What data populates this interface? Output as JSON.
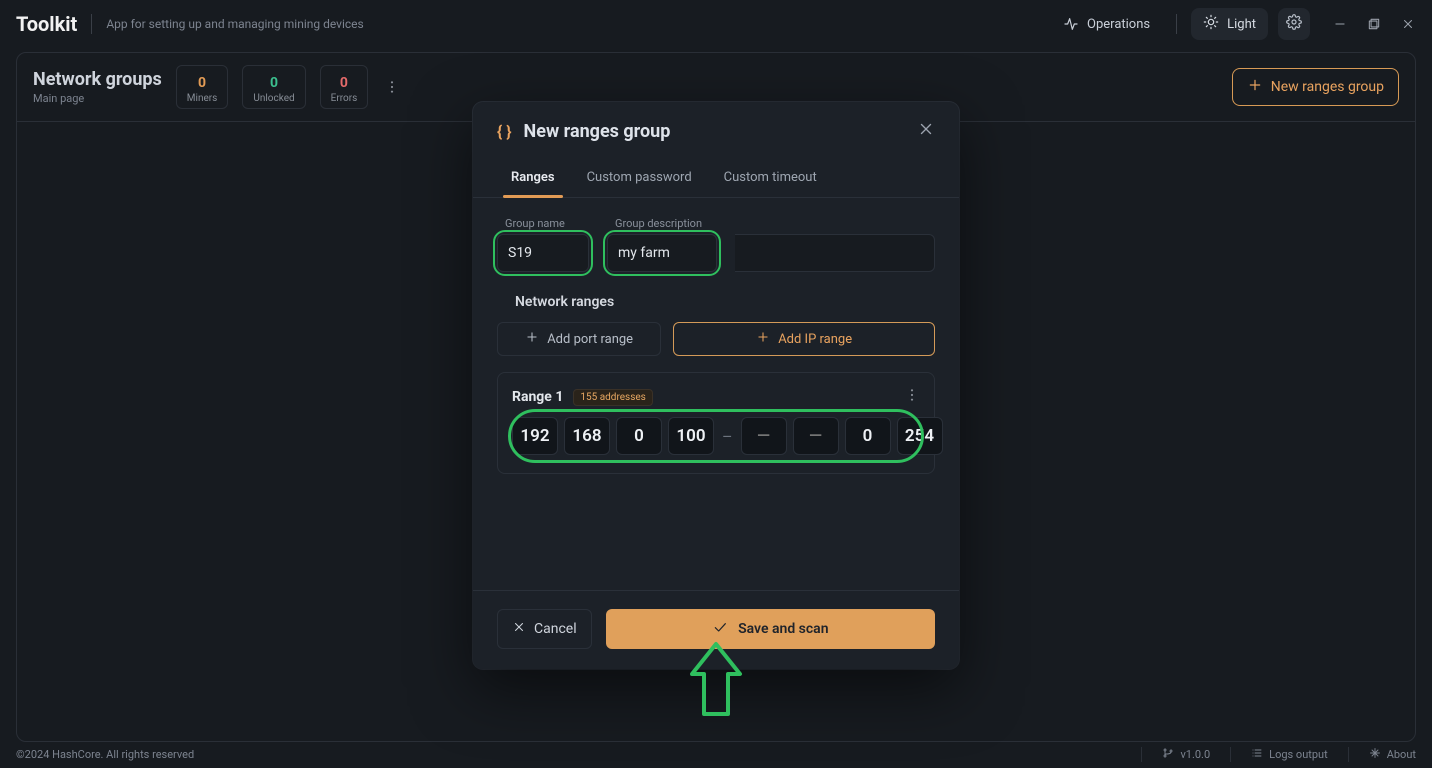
{
  "titlebar": {
    "brand": "Toolkit",
    "tagline": "App for setting up and managing mining devices",
    "operations": "Operations",
    "theme_label": "Light"
  },
  "page": {
    "title": "Network groups",
    "subtitle": "Main page",
    "stats": {
      "miners": {
        "value": "0",
        "label": "Miners"
      },
      "unlocked": {
        "value": "0",
        "label": "Unlocked"
      },
      "errors": {
        "value": "0",
        "label": "Errors"
      }
    },
    "new_group_btn": "New ranges group"
  },
  "modal": {
    "title": "New ranges group",
    "tabs": {
      "ranges": "Ranges",
      "password": "Custom password",
      "timeout": "Custom timeout"
    },
    "group_name_label": "Group name",
    "group_name_value": "S19",
    "group_desc_label": "Group description",
    "group_desc_value": "my farm",
    "section_title": "Network ranges",
    "add_port_range": "Add port range",
    "add_ip_range": "Add IP range",
    "range": {
      "name": "Range 1",
      "addresses_chip": "155 addresses",
      "start": [
        "192",
        "168",
        "0",
        "100"
      ],
      "end_placeholder": "—",
      "end_tail": [
        "0",
        "254"
      ]
    },
    "cancel": "Cancel",
    "save": "Save and scan"
  },
  "footer": {
    "copyright": "©2024 HashCore. All rights reserved",
    "version": "v1.0.0",
    "logs": "Logs output",
    "about": "About"
  }
}
